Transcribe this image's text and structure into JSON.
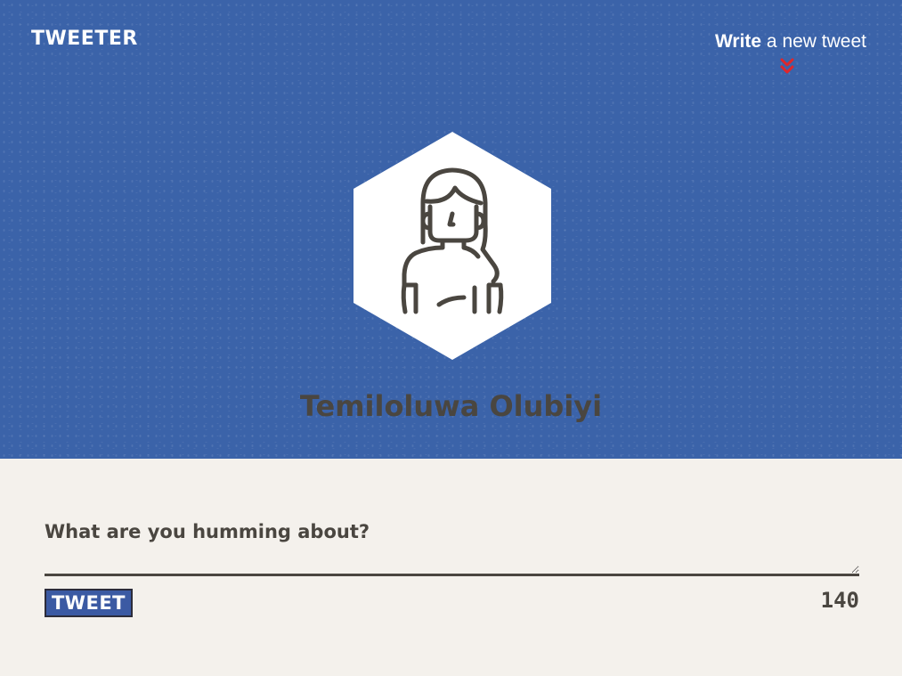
{
  "header": {
    "logo": "TWEETER",
    "write_bold": "Write",
    "write_rest": " a new tweet",
    "chevron_icon": "double-chevron-down-icon",
    "chevron_color": "#e0262a"
  },
  "profile": {
    "avatar_icon": "woman-avatar-icon",
    "name": "Temiloluwa Olubiyi"
  },
  "composer": {
    "placeholder": "What are you humming about?",
    "value": "",
    "button_label": "TWEET",
    "char_count": "140"
  },
  "colors": {
    "hero_background": "#3b63a9",
    "page_background": "#f4f1ec",
    "text": "#4a4640",
    "button": "#3b5aa3"
  }
}
